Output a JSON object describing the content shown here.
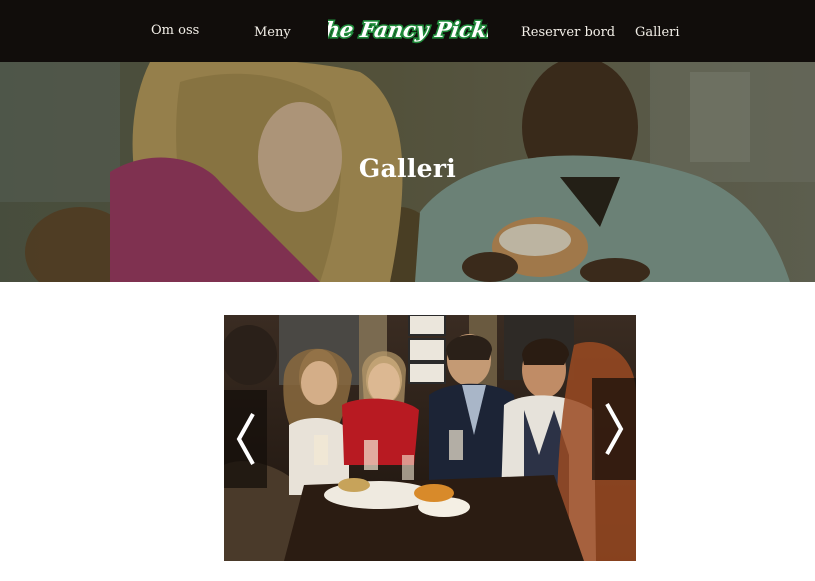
{
  "nav": {
    "about_label": "Om oss",
    "menu_label": "Meny",
    "logo_text": "The Fancy Pickle",
    "reserve_label": "Reserver bord",
    "gallery_label": "Galleri"
  },
  "hero": {
    "title": "Galleri"
  },
  "gallery": {
    "prev_icon": "chevron-left-icon",
    "next_icon": "chevron-right-icon"
  },
  "colors": {
    "navbar_bg": "#110d0b",
    "logo_green": "#1f8a3a",
    "nav_text": "#f3efe8",
    "hero_overlay": "#4a4a2e"
  }
}
